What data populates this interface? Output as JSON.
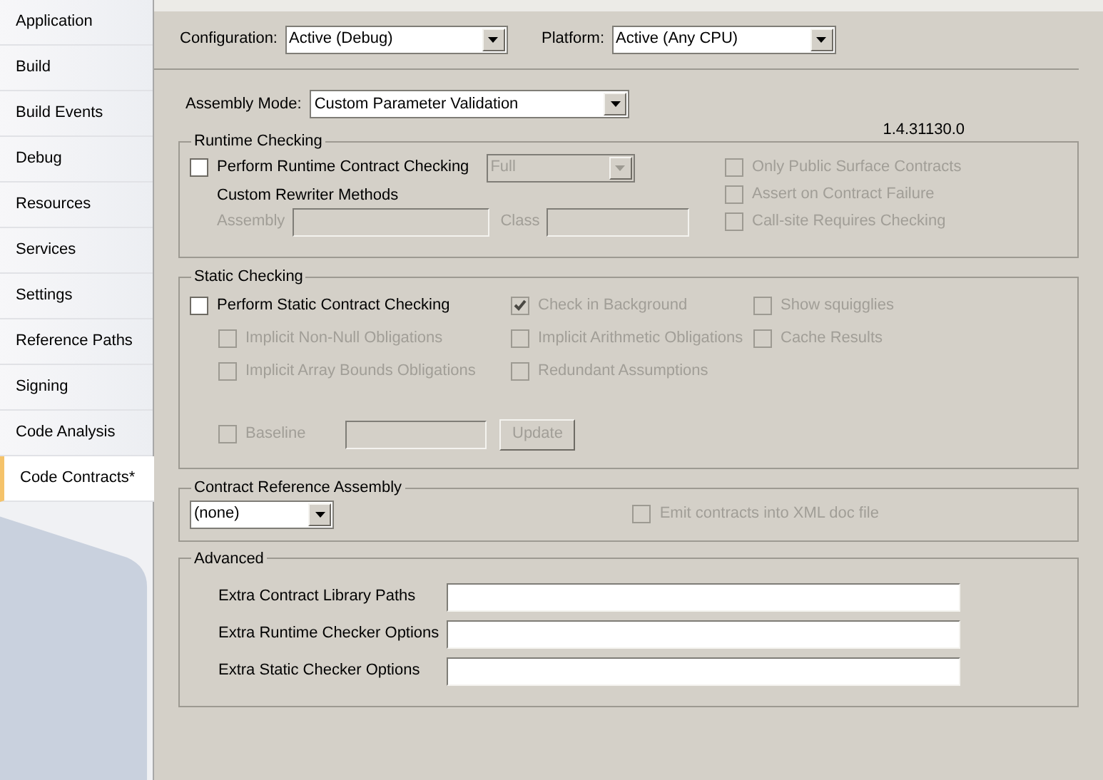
{
  "tabs": [
    {
      "label": "Application",
      "selected": false
    },
    {
      "label": "Build",
      "selected": false
    },
    {
      "label": "Build Events",
      "selected": false
    },
    {
      "label": "Debug",
      "selected": false
    },
    {
      "label": "Resources",
      "selected": false
    },
    {
      "label": "Services",
      "selected": false
    },
    {
      "label": "Settings",
      "selected": false
    },
    {
      "label": "Reference Paths",
      "selected": false
    },
    {
      "label": "Signing",
      "selected": false
    },
    {
      "label": "Code Analysis",
      "selected": false
    },
    {
      "label": "Code Contracts*",
      "selected": true
    }
  ],
  "configuration": {
    "label": "Configuration:",
    "value": "Active (Debug)"
  },
  "platform": {
    "label": "Platform:",
    "value": "Active (Any CPU)"
  },
  "assembly_mode": {
    "label": "Assembly Mode:",
    "value": "Custom Parameter Validation"
  },
  "version": "1.4.31130.0",
  "runtime_checking": {
    "title": "Runtime Checking",
    "perform": {
      "label": "Perform Runtime Contract Checking",
      "checked": false,
      "disabled": false
    },
    "level": {
      "value": "Full",
      "disabled": true
    },
    "rewriter_title": "Custom Rewriter Methods",
    "assembly_label": "Assembly",
    "class_label": "Class",
    "options": [
      {
        "label": "Only Public Surface Contracts",
        "checked": false,
        "disabled": true
      },
      {
        "label": "Assert on Contract Failure",
        "checked": false,
        "disabled": true
      },
      {
        "label": "Call-site Requires Checking",
        "checked": false,
        "disabled": true
      }
    ]
  },
  "static_checking": {
    "title": "Static Checking",
    "perform": {
      "label": "Perform Static Contract Checking",
      "checked": false,
      "disabled": false
    },
    "column_1": [
      {
        "label": "Implicit Non-Null Obligations",
        "checked": false,
        "disabled": true
      },
      {
        "label": "Implicit Array Bounds Obligations",
        "checked": false,
        "disabled": true
      }
    ],
    "column_2": [
      {
        "label": "Check in Background",
        "checked": true,
        "disabled": true
      },
      {
        "label": "Implicit Arithmetic Obligations",
        "checked": false,
        "disabled": true
      },
      {
        "label": "Redundant Assumptions",
        "checked": false,
        "disabled": true
      }
    ],
    "column_3": [
      {
        "label": "Show squigglies",
        "checked": false,
        "disabled": true
      },
      {
        "label": "Cache Results",
        "checked": false,
        "disabled": true
      }
    ],
    "baseline": {
      "label": "Baseline",
      "checked": false,
      "disabled": true
    },
    "update_button": {
      "label": "Update",
      "disabled": true
    }
  },
  "contract_reference_assembly": {
    "title": "Contract Reference Assembly",
    "value": "(none)",
    "emit": {
      "label": "Emit contracts into XML doc file",
      "checked": false,
      "disabled": true
    }
  },
  "advanced": {
    "title": "Advanced",
    "fields": [
      {
        "label": "Extra Contract Library Paths"
      },
      {
        "label": "Extra Runtime Checker Options"
      },
      {
        "label": "Extra Static Checker Options"
      }
    ]
  }
}
